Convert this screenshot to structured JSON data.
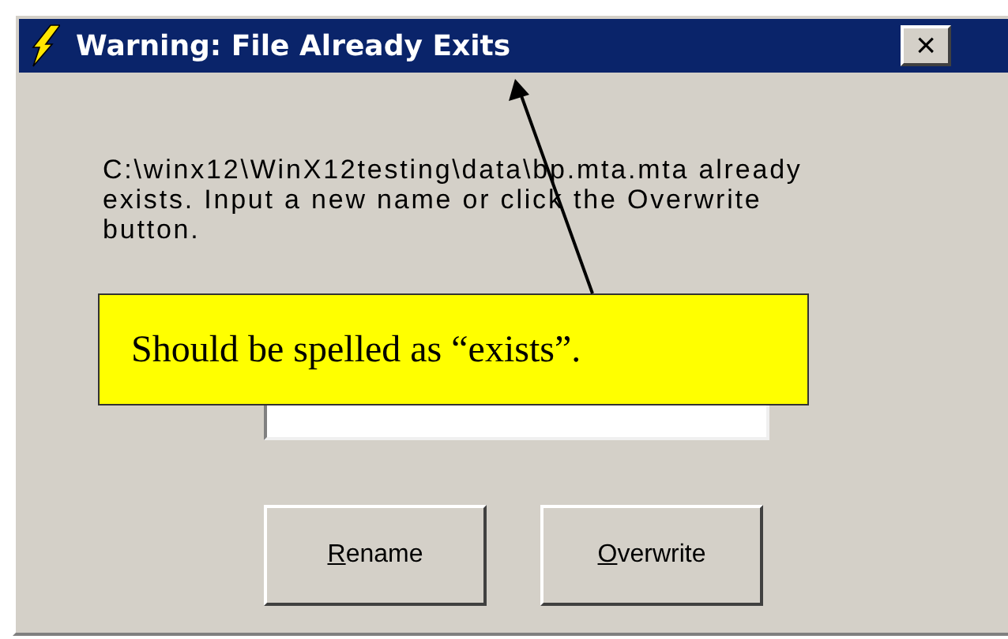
{
  "window": {
    "title": "Warning: File Already Exits",
    "close_button": "×"
  },
  "message": "C:\\winx12\\WinX12testing\\data\\bp.mta.mta already exists.  Input a new name or click the Overwrite button.",
  "buttons": [
    {
      "label": "Rename"
    },
    {
      "label": "Overwrite"
    }
  ],
  "annotation": {
    "text": "Should be spelled as “exists”."
  }
}
